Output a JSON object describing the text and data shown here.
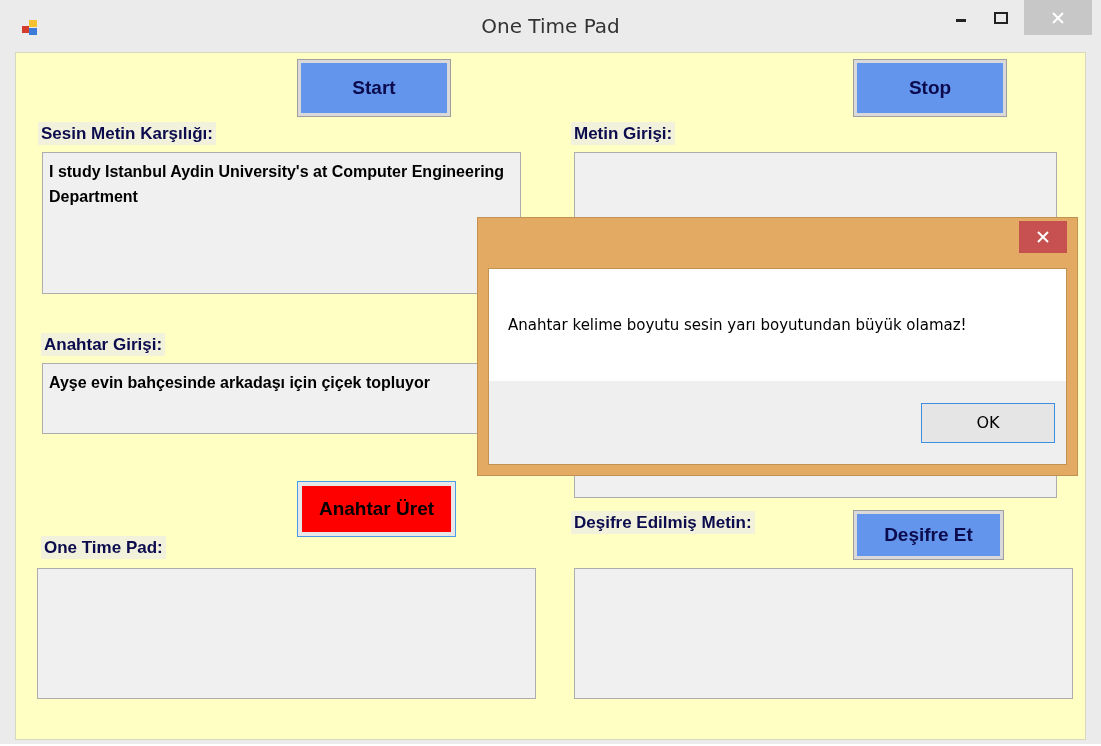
{
  "window": {
    "title": "One Time Pad"
  },
  "start_button": {
    "label": "Start"
  },
  "stop_button": {
    "label": "Stop"
  },
  "speech_text": {
    "label": "Sesin Metin Karşılığı:",
    "value": "I study Istanbul Aydin University's at Computer Engineering Department"
  },
  "text_input": {
    "label": "Metin Girişi:"
  },
  "key_input": {
    "label": "Anahtar Girişi:",
    "value": "Ayşe evin bahçesinde arkadaşı için çiçek topluyor"
  },
  "generate_key_button": {
    "label": "Anahtar Üret"
  },
  "one_time_pad": {
    "label": "One Time Pad:"
  },
  "decrypt_button": {
    "label": "Deşifre Et"
  },
  "decrypted_text": {
    "label": "Deşifre Edilmiş Metin:"
  },
  "dialog": {
    "message": "Anahtar kelime boyutu sesin yarı boyutundan büyük olamaz!",
    "button": "OK"
  }
}
